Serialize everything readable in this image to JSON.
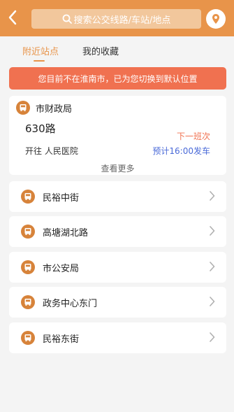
{
  "header": {
    "search_placeholder": "搜索公交线路/车站/地点",
    "accent_color": "#e8944a"
  },
  "tabs": [
    {
      "label": "附近站点",
      "active": true
    },
    {
      "label": "我的收藏",
      "active": false
    }
  ],
  "notice": {
    "text": "您目前不在淮南市，已为您切换到默认位置",
    "color": "#f07150"
  },
  "nearby": {
    "station": "市财政局",
    "route": "630路",
    "next_label": "下一班次",
    "destination": "开往 人民医院",
    "departure": "预计16:00发车",
    "more": "查看更多"
  },
  "stations": [
    {
      "name": "民裕中街"
    },
    {
      "name": "高塘湖北路"
    },
    {
      "name": "市公安局"
    },
    {
      "name": "政务中心东门"
    },
    {
      "name": "民裕东街"
    }
  ],
  "icons": {
    "back": "chevron-left-icon",
    "search": "search-icon",
    "location": "location-pin-icon",
    "station": "bus-icon",
    "row_arrow": "chevron-right-icon"
  }
}
